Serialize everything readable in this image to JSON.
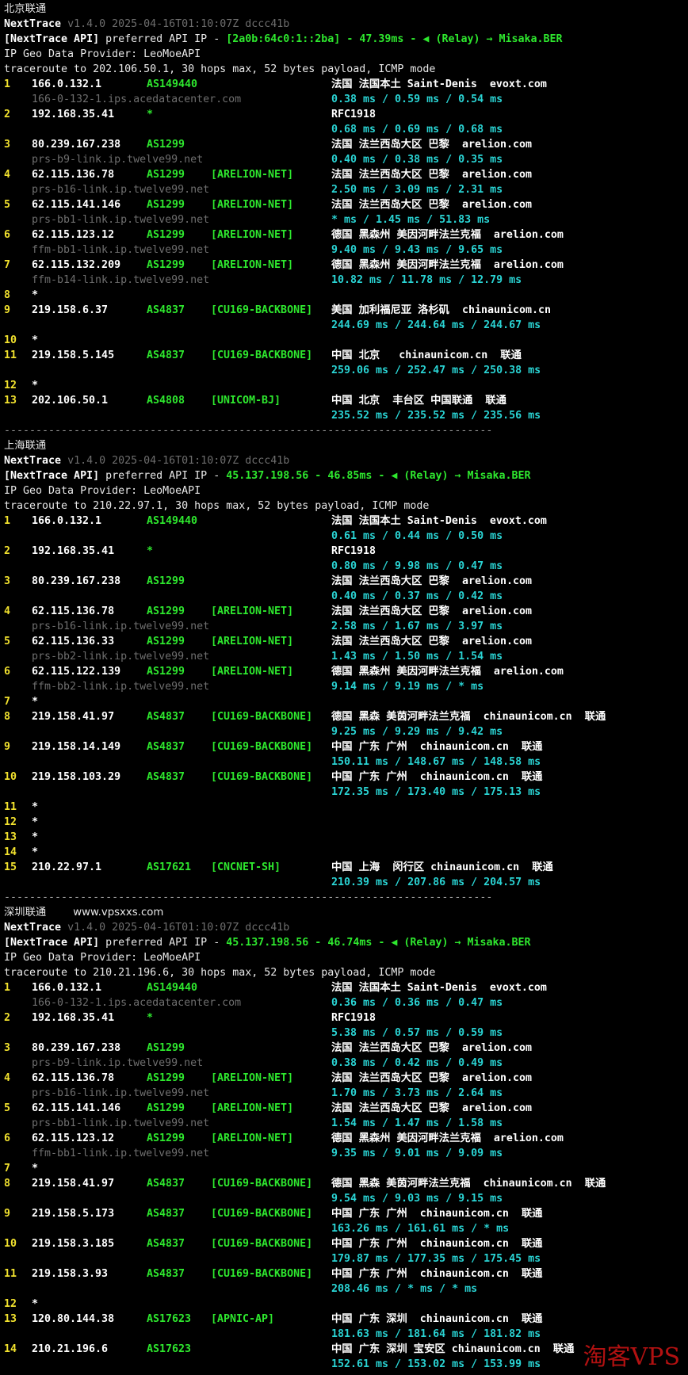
{
  "sections": [
    {
      "title": "北京联通",
      "site": "",
      "version": "v1.4.0 2025-04-16T01:10:07Z dccc41b",
      "api_ip": "[2a0b:64c0:1::2ba]",
      "api_latency": "47.39ms",
      "relay": "(Relay) → Misaka.BER",
      "provider": "IP Geo Data Provider: LeoMoeAPI",
      "target": "traceroute to 202.106.50.1, 30 hops max, 52 bytes payload, ICMP mode",
      "hops": [
        {
          "n": "1",
          "ip": "166.0.132.1",
          "as": "AS149440",
          "tag": "",
          "geo": "法国 法国本土 Saint-Denis  evoxt.com",
          "host": "166-0-132-1.ips.acedatacenter.com",
          "rtt": "0.38 ms / 0.59 ms / 0.54 ms"
        },
        {
          "n": "2",
          "ip": "192.168.35.41",
          "as": "*",
          "tag": "",
          "geo": "RFC1918",
          "host": "",
          "rtt": "0.68 ms / 0.69 ms / 0.68 ms"
        },
        {
          "n": "3",
          "ip": "80.239.167.238",
          "as": "AS1299",
          "tag": "",
          "geo": "法国 法兰西岛大区 巴黎  arelion.com",
          "host": "prs-b9-link.ip.twelve99.net",
          "rtt": "0.40 ms / 0.38 ms / 0.35 ms"
        },
        {
          "n": "4",
          "ip": "62.115.136.78",
          "as": "AS1299",
          "tag": "[ARELION-NET]",
          "geo": "法国 法兰西岛大区 巴黎  arelion.com",
          "host": "prs-b16-link.ip.twelve99.net",
          "rtt": "2.50 ms / 3.09 ms / 2.31 ms"
        },
        {
          "n": "5",
          "ip": "62.115.141.146",
          "as": "AS1299",
          "tag": "[ARELION-NET]",
          "geo": "法国 法兰西岛大区 巴黎  arelion.com",
          "host": "prs-bb1-link.ip.twelve99.net",
          "rtt": "* ms / 1.45 ms / 51.83 ms"
        },
        {
          "n": "6",
          "ip": "62.115.123.12",
          "as": "AS1299",
          "tag": "[ARELION-NET]",
          "geo": "德国 黑森州 美因河畔法兰克福  arelion.com",
          "host": "ffm-bb1-link.ip.twelve99.net",
          "rtt": "9.40 ms / 9.43 ms / 9.65 ms"
        },
        {
          "n": "7",
          "ip": "62.115.132.209",
          "as": "AS1299",
          "tag": "[ARELION-NET]",
          "geo": "德国 黑森州 美因河畔法兰克福  arelion.com",
          "host": "ffm-b14-link.ip.twelve99.net",
          "rtt": "10.82 ms / 11.78 ms / 12.79 ms"
        },
        {
          "n": "8",
          "star": true
        },
        {
          "n": "9",
          "ip": "219.158.6.37",
          "as": "AS4837",
          "tag": "[CU169-BACKBONE]",
          "geo": "美国 加利福尼亚 洛杉矶  chinaunicom.cn",
          "host": "",
          "rtt": "244.69 ms / 244.64 ms / 244.67 ms"
        },
        {
          "n": "10",
          "star": true
        },
        {
          "n": "11",
          "ip": "219.158.5.145",
          "as": "AS4837",
          "tag": "[CU169-BACKBONE]",
          "geo": "中国 北京   chinaunicom.cn  联通",
          "host": "",
          "rtt": "259.06 ms / 252.47 ms / 250.38 ms"
        },
        {
          "n": "12",
          "star": true
        },
        {
          "n": "13",
          "ip": "202.106.50.1",
          "as": "AS4808",
          "tag": "[UNICOM-BJ]",
          "geo": "中国 北京  丰台区 中国联通  联通",
          "host": "",
          "rtt": "235.52 ms / 235.52 ms / 235.56 ms"
        }
      ]
    },
    {
      "title": "上海联通",
      "site": "",
      "version": "v1.4.0 2025-04-16T01:10:07Z dccc41b",
      "api_ip": "45.137.198.56",
      "api_latency": "46.85ms",
      "relay": "(Relay) → Misaka.BER",
      "provider": "IP Geo Data Provider: LeoMoeAPI",
      "target": "traceroute to 210.22.97.1, 30 hops max, 52 bytes payload, ICMP mode",
      "hops": [
        {
          "n": "1",
          "ip": "166.0.132.1",
          "as": "AS149440",
          "tag": "",
          "geo": "法国 法国本土 Saint-Denis  evoxt.com",
          "host": "",
          "rtt": "0.61 ms / 0.44 ms / 0.50 ms"
        },
        {
          "n": "2",
          "ip": "192.168.35.41",
          "as": "*",
          "tag": "",
          "geo": "RFC1918",
          "host": "",
          "rtt": "0.80 ms / 9.98 ms / 0.47 ms"
        },
        {
          "n": "3",
          "ip": "80.239.167.238",
          "as": "AS1299",
          "tag": "",
          "geo": "法国 法兰西岛大区 巴黎  arelion.com",
          "host": "",
          "rtt": "0.40 ms / 0.37 ms / 0.42 ms"
        },
        {
          "n": "4",
          "ip": "62.115.136.78",
          "as": "AS1299",
          "tag": "[ARELION-NET]",
          "geo": "法国 法兰西岛大区 巴黎  arelion.com",
          "host": "prs-b16-link.ip.twelve99.net",
          "rtt": "2.58 ms / 1.67 ms / 3.97 ms"
        },
        {
          "n": "5",
          "ip": "62.115.136.33",
          "as": "AS1299",
          "tag": "[ARELION-NET]",
          "geo": "法国 法兰西岛大区 巴黎  arelion.com",
          "host": "prs-bb2-link.ip.twelve99.net",
          "rtt": "1.43 ms / 1.50 ms / 1.54 ms"
        },
        {
          "n": "6",
          "ip": "62.115.122.139",
          "as": "AS1299",
          "tag": "[ARELION-NET]",
          "geo": "德国 黑森州 美因河畔法兰克福  arelion.com",
          "host": "ffm-bb2-link.ip.twelve99.net",
          "rtt": "9.14 ms / 9.19 ms / * ms"
        },
        {
          "n": "7",
          "star": true
        },
        {
          "n": "8",
          "ip": "219.158.41.97",
          "as": "AS4837",
          "tag": "[CU169-BACKBONE]",
          "geo": "德国 黑森 美茵河畔法兰克福  chinaunicom.cn  联通",
          "host": "",
          "rtt": "9.25 ms / 9.29 ms / 9.42 ms"
        },
        {
          "n": "9",
          "ip": "219.158.14.149",
          "as": "AS4837",
          "tag": "[CU169-BACKBONE]",
          "geo": "中国 广东 广州  chinaunicom.cn  联通",
          "host": "",
          "rtt": "150.11 ms / 148.67 ms / 148.58 ms"
        },
        {
          "n": "10",
          "ip": "219.158.103.29",
          "as": "AS4837",
          "tag": "[CU169-BACKBONE]",
          "geo": "中国 广东 广州  chinaunicom.cn  联通",
          "host": "",
          "rtt": "172.35 ms / 173.40 ms / 175.13 ms"
        },
        {
          "n": "11",
          "star": true
        },
        {
          "n": "12",
          "star": true
        },
        {
          "n": "13",
          "star": true
        },
        {
          "n": "14",
          "star": true
        },
        {
          "n": "15",
          "ip": "210.22.97.1",
          "as": "AS17621",
          "tag": "[CNCNET-SH]",
          "geo": "中国 上海  闵行区 chinaunicom.cn  联通",
          "host": "",
          "rtt": "210.39 ms / 207.86 ms / 204.57 ms"
        }
      ]
    },
    {
      "title": "深圳联通",
      "site": "www.vpsxxs.com",
      "version": "v1.4.0 2025-04-16T01:10:07Z dccc41b",
      "api_ip": "45.137.198.56",
      "api_latency": "46.74ms",
      "relay": "(Relay) → Misaka.BER",
      "provider": "IP Geo Data Provider: LeoMoeAPI",
      "target": "traceroute to 210.21.196.6, 30 hops max, 52 bytes payload, ICMP mode",
      "hops": [
        {
          "n": "1",
          "ip": "166.0.132.1",
          "as": "AS149440",
          "tag": "",
          "geo": "法国 法国本土 Saint-Denis  evoxt.com",
          "host": "166-0-132-1.ips.acedatacenter.com",
          "rtt": "0.36 ms / 0.36 ms / 0.47 ms"
        },
        {
          "n": "2",
          "ip": "192.168.35.41",
          "as": "*",
          "tag": "",
          "geo": "RFC1918",
          "host": "",
          "rtt": "5.38 ms / 0.57 ms / 0.59 ms"
        },
        {
          "n": "3",
          "ip": "80.239.167.238",
          "as": "AS1299",
          "tag": "",
          "geo": "法国 法兰西岛大区 巴黎  arelion.com",
          "host": "prs-b9-link.ip.twelve99.net",
          "rtt": "0.38 ms / 0.42 ms / 0.49 ms"
        },
        {
          "n": "4",
          "ip": "62.115.136.78",
          "as": "AS1299",
          "tag": "[ARELION-NET]",
          "geo": "法国 法兰西岛大区 巴黎  arelion.com",
          "host": "prs-b16-link.ip.twelve99.net",
          "rtt": "1.70 ms / 3.73 ms / 2.64 ms"
        },
        {
          "n": "5",
          "ip": "62.115.141.146",
          "as": "AS1299",
          "tag": "[ARELION-NET]",
          "geo": "法国 法兰西岛大区 巴黎  arelion.com",
          "host": "prs-bb1-link.ip.twelve99.net",
          "rtt": "1.54 ms / 1.47 ms / 1.58 ms"
        },
        {
          "n": "6",
          "ip": "62.115.123.12",
          "as": "AS1299",
          "tag": "[ARELION-NET]",
          "geo": "德国 黑森州 美因河畔法兰克福  arelion.com",
          "host": "ffm-bb1-link.ip.twelve99.net",
          "rtt": "9.35 ms / 9.01 ms / 9.09 ms"
        },
        {
          "n": "7",
          "star": true
        },
        {
          "n": "8",
          "ip": "219.158.41.97",
          "as": "AS4837",
          "tag": "[CU169-BACKBONE]",
          "geo": "德国 黑森 美茵河畔法兰克福  chinaunicom.cn  联通",
          "host": "",
          "rtt": "9.54 ms / 9.03 ms / 9.15 ms"
        },
        {
          "n": "9",
          "ip": "219.158.5.173",
          "as": "AS4837",
          "tag": "[CU169-BACKBONE]",
          "geo": "中国 广东 广州  chinaunicom.cn  联通",
          "host": "",
          "rtt": "163.26 ms / 161.61 ms / * ms"
        },
        {
          "n": "10",
          "ip": "219.158.3.185",
          "as": "AS4837",
          "tag": "[CU169-BACKBONE]",
          "geo": "中国 广东 广州  chinaunicom.cn  联通",
          "host": "",
          "rtt": "179.87 ms / 177.35 ms / 175.45 ms"
        },
        {
          "n": "11",
          "ip": "219.158.3.93",
          "as": "AS4837",
          "tag": "[CU169-BACKBONE]",
          "geo": "中国 广东 广州  chinaunicom.cn  联通",
          "host": "",
          "rtt": "208.46 ms / * ms / * ms"
        },
        {
          "n": "12",
          "star": true
        },
        {
          "n": "13",
          "ip": "120.80.144.38",
          "as": "AS17623",
          "tag": "[APNIC-AP]",
          "geo": "中国 广东 深圳  chinaunicom.cn  联通",
          "host": "",
          "rtt": "181.63 ms / 181.64 ms / 181.82 ms"
        },
        {
          "n": "14",
          "ip": "210.21.196.6",
          "as": "AS17623",
          "tag": "",
          "geo": "中国 广东 深圳 宝安区 chinaunicom.cn  联通",
          "host": "",
          "rtt": "152.61 ms / 153.02 ms / 153.99 ms"
        }
      ]
    }
  ],
  "labels": {
    "app": "NextTrace",
    "api_prefix": "[NextTrace API]",
    "api_text": " preferred API IP - ",
    "dash": " - ",
    "relay_icon": "◀",
    "separator": "-----------------------------------------------------------------------------",
    "star": "*"
  },
  "watermark": "淘客VPS",
  "colors": {
    "background": "#000000",
    "green": "#2ee82e",
    "cyan": "#2ad4d4",
    "yellow": "#f2e22e",
    "gray": "#6e6e6e",
    "watermark": "#d01414"
  }
}
